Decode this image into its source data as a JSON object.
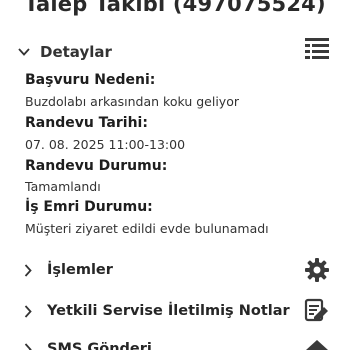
{
  "header": {
    "title": "Talep Takibi (497075524)"
  },
  "details": {
    "label": "Detaylar",
    "icon": "list-view-icon",
    "fields": [
      {
        "label": "Başvuru Nedeni:",
        "value": "Buzdolabı arkasından koku geliyor"
      },
      {
        "label": "Randevu Tarihi:",
        "value": "07. 08. 2025 11:00-13:00"
      },
      {
        "label": "Randevu Durumu:",
        "value": "Tamamlandı"
      },
      {
        "label": "İş Emri Durumu:",
        "value": "Müşteri ziyaret edildi evde bulunamadı"
      }
    ]
  },
  "sections": [
    {
      "label": "İşlemler",
      "icon": "gear-icon"
    },
    {
      "label": "Yetkili Servise İletilmiş Notlar",
      "icon": "notes-edit-icon"
    },
    {
      "label": "SMS Gönderi",
      "icon": "sms-icon"
    }
  ],
  "colors": {
    "text": "#1e1e1e",
    "icon": "#3a3a3a"
  }
}
